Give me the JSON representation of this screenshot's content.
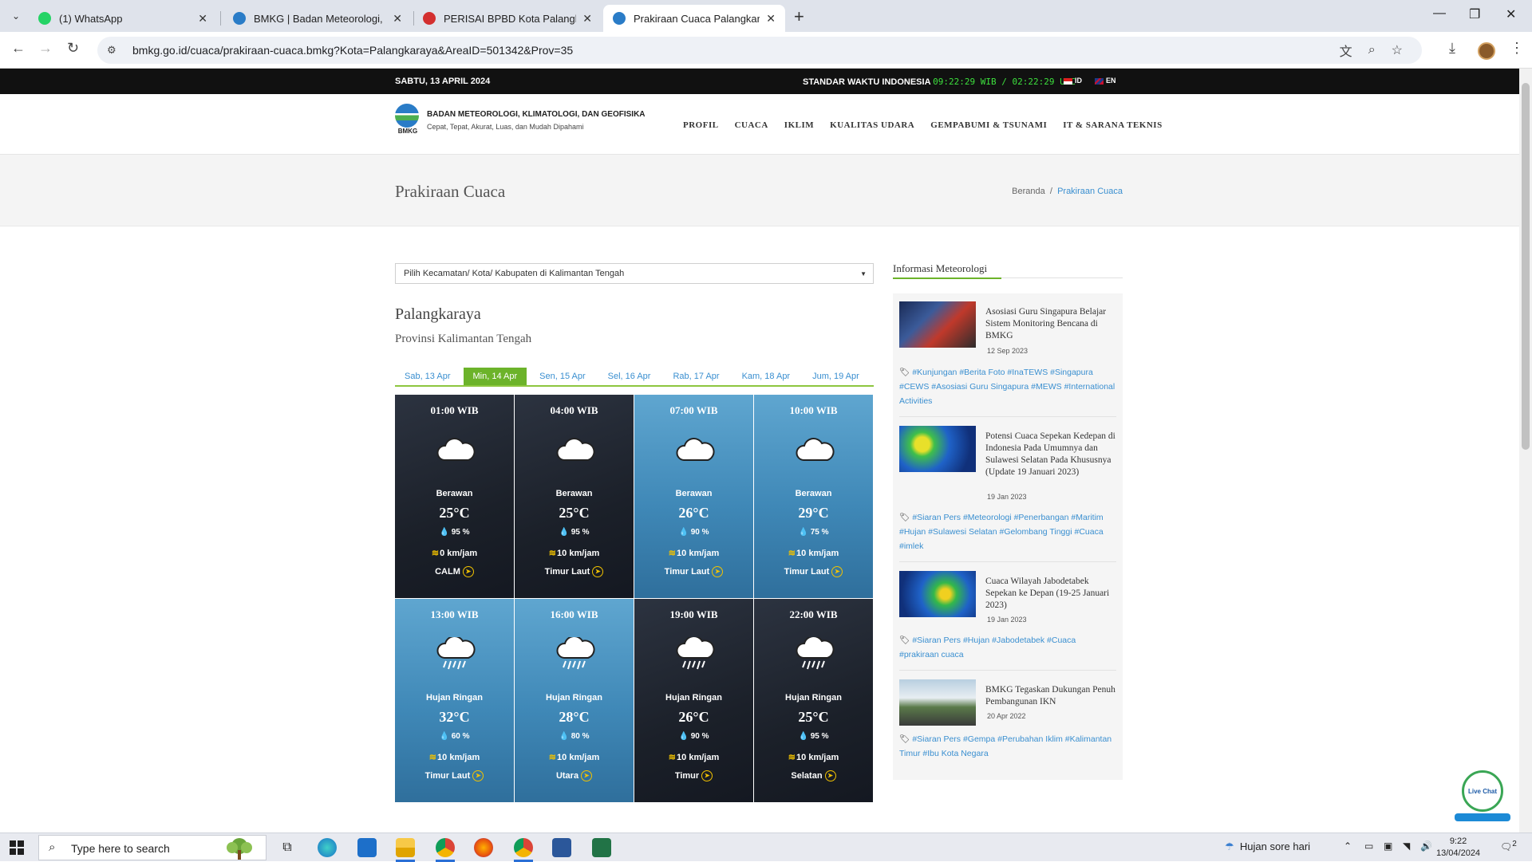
{
  "browser": {
    "tabs": [
      {
        "title": "(1) WhatsApp",
        "color": "#25d366"
      },
      {
        "title": "BMKG | Badan Meteorologi, Klim",
        "color": "#2a7cc7"
      },
      {
        "title": "PERISAI BPBD Kota Palangka Ra",
        "color": "#d32f2f"
      },
      {
        "title": "Prakiraan Cuaca Palangkaraya -",
        "color": "#2a7cc7"
      }
    ],
    "url": "bmkg.go.id/cuaca/prakiraan-cuaca.bmkg?Kota=Palangkaraya&AreaID=501342&Prov=35"
  },
  "topbar": {
    "date": "SABTU, 13 APRIL 2024",
    "standard_label": "STANDAR WAKTU INDONESIA",
    "clock": "09:22:29 WIB / 02:22:29 UTC",
    "lang_id": "ID",
    "lang_en": "EN"
  },
  "header": {
    "logo_abbr": "BMKG",
    "org_name": "BADAN METEOROLOGI, KLIMATOLOGI, DAN GEOFISIKA",
    "tagline": "Cepat, Tepat, Akurat, Luas, dan Mudah Dipahami",
    "nav": [
      "PROFIL",
      "CUACA",
      "IKLIM",
      "KUALITAS UDARA",
      "GEMPABUMI & TSUNAMI",
      "IT & SARANA TEKNIS"
    ]
  },
  "titlebar": {
    "title": "Prakiraan Cuaca",
    "breadcrumb_home": "Beranda",
    "breadcrumb_sep": "/",
    "breadcrumb_current": "Prakiraan Cuaca"
  },
  "forecast": {
    "select_placeholder": "Pilih Kecamatan/ Kota/ Kabupaten di Kalimantan Tengah",
    "city": "Palangkaraya",
    "province": "Provinsi Kalimantan Tengah",
    "days": [
      "Sab, 13 Apr",
      "Min, 14 Apr",
      "Sen, 15 Apr",
      "Sel, 16 Apr",
      "Rab, 17 Apr",
      "Kam, 18 Apr",
      "Jum, 19 Apr"
    ],
    "active_day": 1,
    "slots": [
      {
        "time": "01:00 WIB",
        "condition": "Berawan",
        "icon": "cloud-icon",
        "temp": "25°C",
        "humidity": "95 %",
        "wind": "0 km/jam",
        "direction": "CALM",
        "theme": "night"
      },
      {
        "time": "04:00 WIB",
        "condition": "Berawan",
        "icon": "cloud-icon",
        "temp": "25°C",
        "humidity": "95 %",
        "wind": "10 km/jam",
        "direction": "Timur Laut",
        "theme": "night"
      },
      {
        "time": "07:00 WIB",
        "condition": "Berawan",
        "icon": "cloud-icon",
        "temp": "26°C",
        "humidity": "90 %",
        "wind": "10 km/jam",
        "direction": "Timur Laut",
        "theme": "day"
      },
      {
        "time": "10:00 WIB",
        "condition": "Berawan",
        "icon": "cloud-icon",
        "temp": "29°C",
        "humidity": "75 %",
        "wind": "10 km/jam",
        "direction": "Timur Laut",
        "theme": "day"
      },
      {
        "time": "13:00 WIB",
        "condition": "Hujan Ringan",
        "icon": "rain-cloud-icon",
        "temp": "32°C",
        "humidity": "60 %",
        "wind": "10 km/jam",
        "direction": "Timur Laut",
        "theme": "day"
      },
      {
        "time": "16:00 WIB",
        "condition": "Hujan Ringan",
        "icon": "rain-cloud-icon",
        "temp": "28°C",
        "humidity": "80 %",
        "wind": "10 km/jam",
        "direction": "Utara",
        "theme": "day"
      },
      {
        "time": "19:00 WIB",
        "condition": "Hujan Ringan",
        "icon": "rain-cloud-icon",
        "temp": "26°C",
        "humidity": "90 %",
        "wind": "10 km/jam",
        "direction": "Timur",
        "theme": "night"
      },
      {
        "time": "22:00 WIB",
        "condition": "Hujan Ringan",
        "icon": "rain-cloud-icon",
        "temp": "25°C",
        "humidity": "95 %",
        "wind": "10 km/jam",
        "direction": "Selatan",
        "theme": "night"
      }
    ]
  },
  "sidebar": {
    "title": "Informasi Meteorologi",
    "news": [
      {
        "title": "Asosiasi Guru Singapura Belajar Sistem Monitoring Bencana di BMKG",
        "date": "12 Sep 2023",
        "tags": "#Kunjungan #Berita Foto #InaTEWS #Singapura #CEWS #Asosiasi Guru Singapura #MEWS #International Activities"
      },
      {
        "title": "Potensi Cuaca Sepekan Kedepan di Indonesia Pada Umumnya dan Sulawesi Selatan Pada Khususnya (Update 19 Januari 2023)",
        "date": "19 Jan 2023",
        "tags": "#Siaran Pers #Meteorologi #Penerbangan #Maritim #Hujan #Sulawesi Selatan #Gelombang Tinggi #Cuaca #imlek"
      },
      {
        "title": "Cuaca Wilayah Jabodetabek Sepekan ke Depan (19-25 Januari 2023)",
        "date": "19 Jan 2023",
        "tags": "#Siaran Pers #Hujan #Jabodetabek #Cuaca #prakiraan cuaca"
      },
      {
        "title": "BMKG Tegaskan Dukungan Penuh Pembangunan IKN",
        "date": "20 Apr 2022",
        "tags": "#Siaran Pers #Gempa #Perubahan Iklim #Kalimantan Timur #Ibu Kota Negara"
      }
    ]
  },
  "livechat": {
    "label": "Live Chat"
  },
  "taskbar": {
    "search_placeholder": "Type here to search",
    "weather": "Hujan sore hari",
    "time": "9:22",
    "date": "13/04/2024",
    "notifications": "2"
  }
}
